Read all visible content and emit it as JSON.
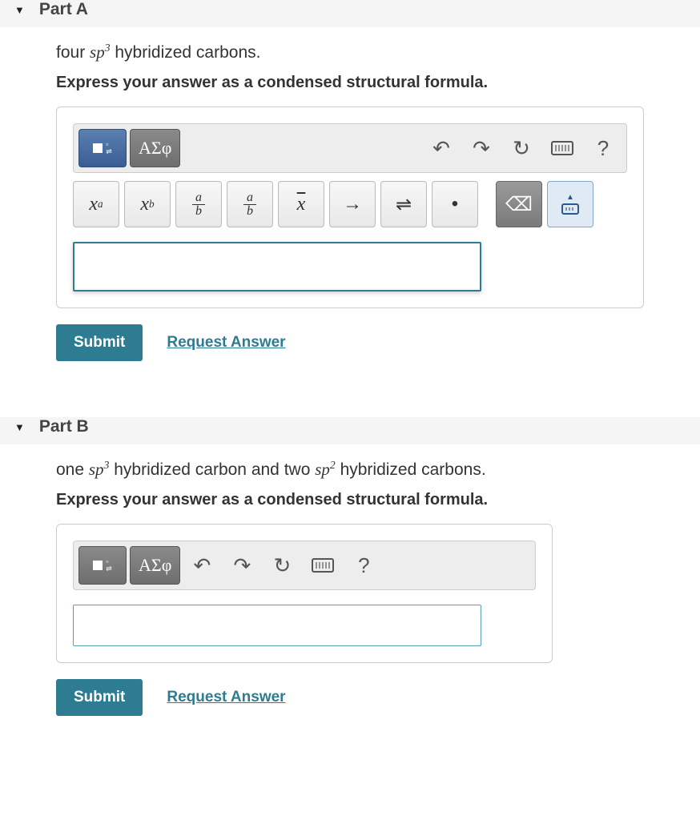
{
  "partA": {
    "header": "Part A",
    "prompt_pre": "four ",
    "prompt_math_base": "sp",
    "prompt_math_sup": "3",
    "prompt_post": " hybridized carbons.",
    "instruction": "Express your answer as a condensed structural formula.",
    "greek_label": "ΑΣφ",
    "help_label": "?",
    "tool_superscript": "xᵃ",
    "tool_subscript": "xᵦ",
    "tool_arrow": "→",
    "tool_equil": "⇌",
    "tool_dot": "•",
    "answer_value": "",
    "submit": "Submit",
    "request": "Request Answer"
  },
  "partB": {
    "header": "Part B",
    "prompt_pre": "one ",
    "prompt_math_base1": "sp",
    "prompt_math_sup1": "3",
    "prompt_mid": " hybridized carbon and two ",
    "prompt_math_base2": "sp",
    "prompt_math_sup2": "2",
    "prompt_post": " hybridized carbons.",
    "instruction": "Express your answer as a condensed structural formula.",
    "greek_label": "ΑΣφ",
    "help_label": "?",
    "answer_value": "",
    "submit": "Submit",
    "request": "Request Answer"
  }
}
